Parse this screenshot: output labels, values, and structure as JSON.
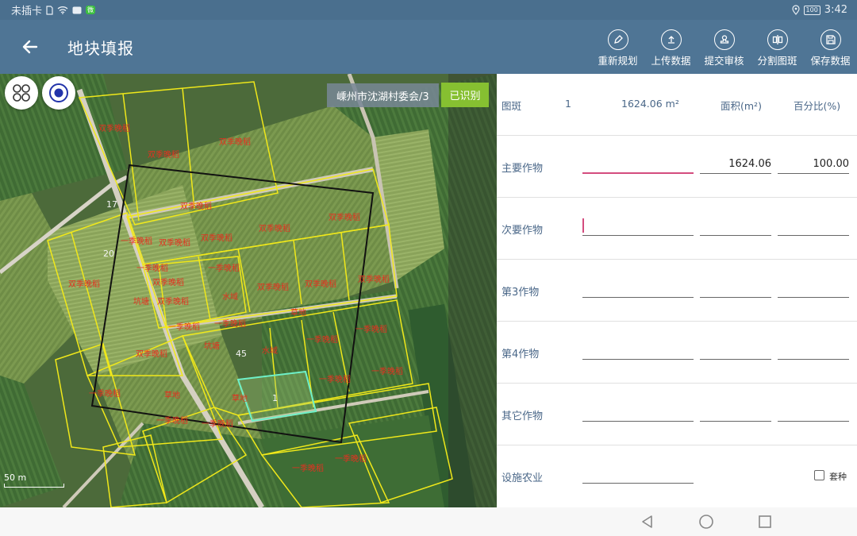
{
  "status_bar": {
    "left_text": "未插卡",
    "battery": "100",
    "time": "3:42"
  },
  "app_bar": {
    "title": "地块填报",
    "actions": [
      {
        "label": "重新规划",
        "icon": "edit-pen-icon"
      },
      {
        "label": "上传数据",
        "icon": "upload-icon"
      },
      {
        "label": "提交审核",
        "icon": "stamp-icon"
      },
      {
        "label": "分割图斑",
        "icon": "split-icon"
      },
      {
        "label": "保存数据",
        "icon": "save-icon"
      }
    ]
  },
  "map": {
    "village": "嵊州市沈湖村委会/3",
    "recognized_button": "已识别",
    "scale_label": "50 m",
    "plot_labels": [
      "双季晚稻",
      "双季晚稻",
      "双季晚稻",
      "双季晚稻",
      "一季晚稻",
      "双季晚稻",
      "双季晚稻",
      "双季晚稻",
      "一季晚稻",
      "一季晚稻",
      "双季晚稻",
      "双季晚稻",
      "双季晚稻",
      "双季晚稻",
      "水域",
      "坑塘",
      "双季晚稻",
      "一季晚稻",
      "双季晚稻",
      "草地",
      "一季晚稻",
      "一季晚稻",
      "双季晚稻",
      "坑塘",
      "水域",
      "一季晚稻",
      "一季晚稻",
      "一季晚稻",
      "双季晚稻",
      "草地",
      "一季晚稻",
      "一季晚稻",
      "一季晚稻",
      "草地",
      "一季晚稻",
      "一季晚稻"
    ],
    "plot_numbers": [
      "17",
      "20",
      "45",
      "1"
    ]
  },
  "form": {
    "header": {
      "label": "图斑",
      "id": "1",
      "area": "1624.06 m²",
      "col_area": "面积(m²)",
      "col_percent": "百分比(%)"
    },
    "rows": [
      {
        "label": "主要作物",
        "crop": "",
        "area": "1624.06",
        "percent": "100.00"
      },
      {
        "label": "次要作物",
        "crop": "",
        "area": "",
        "percent": ""
      },
      {
        "label": "第3作物",
        "crop": "",
        "area": "",
        "percent": ""
      },
      {
        "label": "第4作物",
        "crop": "",
        "area": "",
        "percent": ""
      },
      {
        "label": "其它作物",
        "crop": "",
        "area": "",
        "percent": ""
      }
    ],
    "facility": {
      "label": "设施农业",
      "value": "",
      "checkbox_label": "套种",
      "checked": false
    }
  },
  "colors": {
    "app_bar": "#4f7595",
    "status_bar": "#4a6f8e",
    "label_blue": "#4a6788",
    "accent_pink": "#d44c7e",
    "plot_border": "#f0e81a",
    "crop_label": "#e53020",
    "recognized": "#86c031"
  }
}
